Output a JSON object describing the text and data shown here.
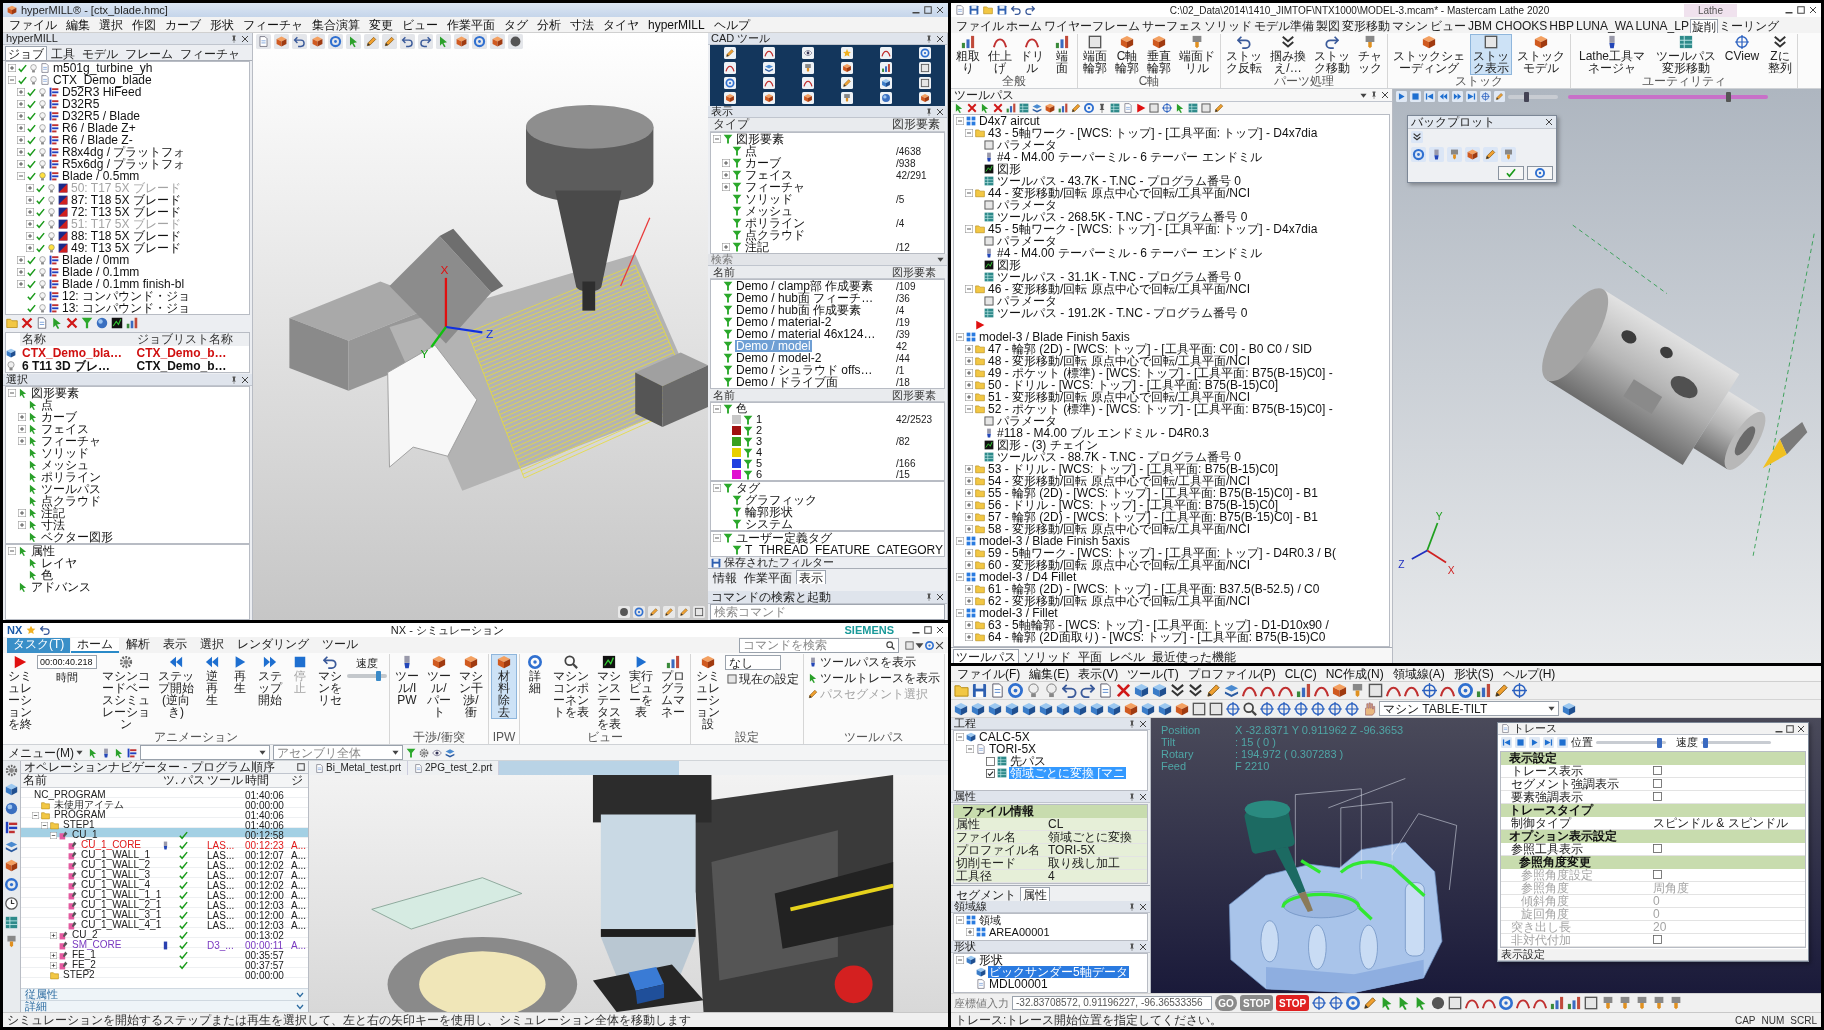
{
  "hypermill": {
    "title": "hyperMILL® - [ctx_blade.hmc]",
    "menu": [
      "ファイル",
      "編集",
      "選択",
      "作図",
      "カーブ",
      "形状",
      "フィーチャ",
      "集合演算",
      "変更",
      "ビュー",
      "作業平面",
      "タグ",
      "分析",
      "寸法",
      "タイヤ",
      "hyperMILL",
      "ヘルプ"
    ],
    "job_panel": {
      "title": "hyperMILL",
      "tabs": [
        {
          "label": "ジョブ",
          "selected": true
        },
        {
          "label": "工具",
          "selected": false
        },
        {
          "label": "モデル",
          "selected": false
        },
        {
          "label": "フレーム",
          "selected": false
        },
        {
          "label": "フィーチャ",
          "selected": false
        }
      ],
      "tree": [
        {
          "label": "m501g_turbine_yh",
          "kind": "project",
          "expanded": false,
          "checked": true,
          "lit": false
        },
        {
          "label": "CTX_Demo_blade",
          "kind": "project",
          "expanded": true,
          "checked": true,
          "lit": false,
          "children": [
            {
              "label": "D52R3 HiFeed",
              "kind": "job",
              "expanded": false,
              "checked": true,
              "lit": false
            },
            {
              "label": "D32R5",
              "kind": "job",
              "expanded": false,
              "checked": true,
              "lit": false
            },
            {
              "label": "D32R5 / Blade",
              "kind": "job",
              "expanded": false,
              "checked": true,
              "lit": false
            },
            {
              "label": "R6 / Blade Z+",
              "kind": "job",
              "expanded": false,
              "checked": true,
              "lit": false
            },
            {
              "label": "R6 / Blade Z-",
              "kind": "job",
              "expanded": false,
              "checked": true,
              "lit": false
            },
            {
              "label": "R8x4dg / プラットフォ",
              "kind": "job",
              "expanded": false,
              "checked": true,
              "lit": false
            },
            {
              "label": "R5x6dg / プラットフォ",
              "kind": "job",
              "expanded": false,
              "checked": true,
              "lit": false
            },
            {
              "label": "Blade / 0.5mm",
              "kind": "job",
              "expanded": true,
              "checked": true,
              "lit": true,
              "children": [
                {
                  "label": "50: T17 5X ブレード",
                  "kind": "operation",
                  "expanded": false,
                  "checked": true,
                  "lit": false,
                  "disabled": true
                },
                {
                  "label": "87: T18 5X ブレード",
                  "kind": "operation",
                  "expanded": false,
                  "checked": true,
                  "lit": false,
                  "disabled": false
                },
                {
                  "label": "72: T13 5X ブレード",
                  "kind": "operation",
                  "expanded": false,
                  "checked": true,
                  "lit": false,
                  "disabled": false
                },
                {
                  "label": "51: T17 5X ブレード",
                  "kind": "operation",
                  "expanded": false,
                  "checked": true,
                  "lit": false,
                  "disabled": true
                },
                {
                  "label": "88: T18 5X ブレード",
                  "kind": "operation",
                  "expanded": false,
                  "checked": true,
                  "lit": false,
                  "disabled": false
                },
                {
                  "label": "49: T13 5X ブレード",
                  "kind": "operation",
                  "expanded": false,
                  "checked": true,
                  "lit": true,
                  "disabled": false
                }
              ]
            },
            {
              "label": "Blade / 0mm",
              "kind": "job",
              "expanded": false,
              "checked": true,
              "lit": false
            },
            {
              "label": "Blade / 0.1mm",
              "kind": "job",
              "expanded": false,
              "checked": true,
              "lit": false
            },
            {
              "label": "Blade / 0.1mm finish-bl",
              "kind": "job",
              "expanded": false,
              "checked": true,
              "lit": false
            },
            {
              "label": "12: コンパウンド・ジョ",
              "kind": "job",
              "checked": true,
              "lit": false
            },
            {
              "label": "13: コンパウンド・ジョ",
              "kind": "job",
              "checked": true,
              "lit": false
            }
          ]
        }
      ],
      "list": {
        "columns": [
          "名称",
          "ジョブリスト名称"
        ],
        "rows": [
          {
            "cells": [
              "CTX_Demo_bla…",
              "CTX_Demo_b…"
            ],
            "active": true
          },
          {
            "cells": [
              "6 T11 3D ブレ…",
              "CTX_Demo_b…"
            ],
            "active": false
          }
        ]
      }
    },
    "selection_panel": {
      "title": "選択",
      "tree": [
        {
          "label": "図形要素",
          "expanded": true,
          "children": [
            {
              "label": "点"
            },
            {
              "label": "カーブ",
              "expanded": false
            },
            {
              "label": "フェイス",
              "expanded": false
            },
            {
              "label": "フィーチャ",
              "expanded": false
            },
            {
              "label": "ソリッド"
            },
            {
              "label": "メッシュ"
            },
            {
              "label": "ポリライン"
            },
            {
              "label": "ツールパス"
            },
            {
              "label": "点クラウド"
            },
            {
              "label": "注記",
              "expanded": false
            },
            {
              "label": "寸法",
              "expanded": false
            },
            {
              "label": "ベクター図形"
            }
          ]
        }
      ],
      "attributes": [
        {
          "label": "属性",
          "expanded": true,
          "children": [
            {
              "label": "レイヤ"
            },
            {
              "label": "色"
            }
          ]
        },
        {
          "label": "アドバンス"
        }
      ]
    },
    "axes": [
      "X",
      "Y",
      "Z"
    ],
    "cad_tools": {
      "title": "CAD ツール"
    },
    "display_panel": {
      "title": "表示",
      "columns": [
        "タイプ",
        "図形要素"
      ],
      "tree": [
        {
          "label": "図形要素",
          "expanded": true,
          "children": [
            {
              "label": "点",
              "count": "/4638"
            },
            {
              "label": "カーブ",
              "count": "/938",
              "expanded": false
            },
            {
              "label": "フェイス",
              "count": "42/291",
              "expanded": false
            },
            {
              "label": "フィーチャ",
              "expanded": false
            },
            {
              "label": "ソリッド",
              "count": "/5"
            },
            {
              "label": "メッシュ"
            },
            {
              "label": "ポリライン",
              "count": "/4"
            },
            {
              "label": "点クラウド"
            },
            {
              "label": "注記",
              "count": "/12",
              "expanded": false
            }
          ]
        }
      ]
    },
    "search_label": "検索",
    "model_list": {
      "columns": [
        "名前",
        "図形要素"
      ],
      "rows": [
        {
          "label": "Demo / clamp部 作成要素",
          "count": "/109",
          "selected": false
        },
        {
          "label": "Demo / hub面 フィーチ…",
          "count": "/36",
          "selected": false
        },
        {
          "label": "Demo / hub面 作成要素",
          "count": "/4",
          "selected": false
        },
        {
          "label": "Demo / material-2",
          "count": "/19",
          "selected": false
        },
        {
          "label": "Demo / material 46x124…",
          "count": "/39",
          "selected": false
        },
        {
          "label": "Demo / model",
          "count": "42",
          "selected": true
        },
        {
          "label": "Demo / model-2",
          "count": "/44",
          "selected": false
        },
        {
          "label": "Demo / シュラウド offs…",
          "count": "/1",
          "selected": false
        },
        {
          "label": "Demo / ドライブ面",
          "count": "/18",
          "selected": false
        }
      ]
    },
    "color_list": {
      "columns": [
        "名前",
        "図形要素"
      ],
      "tree": [
        {
          "label": "色",
          "expanded": true,
          "children": [
            {
              "label": "1",
              "count": "42/2523",
              "color": "#c8c8c8"
            },
            {
              "label": "2",
              "color": "#a01010"
            },
            {
              "label": "3",
              "count": "/82",
              "color": "#3aa020"
            },
            {
              "label": "4",
              "color": "#e8d000"
            },
            {
              "label": "5",
              "count": "/166",
              "color": "#2040e0"
            },
            {
              "label": "6",
              "count": "/15",
              "color": "#e010d0"
            }
          ]
        }
      ]
    },
    "tag_tree": [
      {
        "label": "タグ",
        "expanded": true,
        "children": [
          {
            "label": "グラフィック"
          },
          {
            "label": "輪郭形状"
          },
          {
            "label": "システム"
          }
        ]
      }
    ],
    "user_tag_tree": [
      {
        "label": "ユーザー定義タグ",
        "expanded": true,
        "children": [
          {
            "label": "T_THREAD_FEATURE_CATEGORY"
          }
        ]
      }
    ],
    "saved_filters": "保存されたフィルター",
    "bottom_tabs": [
      {
        "label": "情報",
        "selected": false
      },
      {
        "label": "作業平面",
        "selected": false
      },
      {
        "label": "表示",
        "selected": true
      }
    ],
    "command_panel": {
      "title": "コマンドの検索と起動",
      "placeholder": "検索コマンド"
    }
  },
  "mastercam": {
    "title": "C:\\02_Data\\2014\\1410_JIMTOF\\NTX1000\\MODEL-3.mcam* - Mastercam Lathe 2020",
    "context": "Lathe",
    "tabs": [
      {
        "label": "ファイル",
        "selected": false
      },
      {
        "label": "ホーム",
        "selected": false
      },
      {
        "label": "ワイヤーフレーム",
        "selected": false
      },
      {
        "label": "サーフェス",
        "selected": false
      },
      {
        "label": "ソリッド",
        "selected": false
      },
      {
        "label": "モデル準備",
        "selected": false
      },
      {
        "label": "製図",
        "selected": false
      },
      {
        "label": "変形移動",
        "selected": false
      },
      {
        "label": "マシン",
        "selected": false
      },
      {
        "label": "ビュー",
        "selected": false
      },
      {
        "label": "JBM CHOOKS",
        "selected": false
      },
      {
        "label": "HBP",
        "selected": false
      },
      {
        "label": "LUNA_WA",
        "selected": false
      },
      {
        "label": "LUNA_LP",
        "selected": false
      },
      {
        "label": "旋削",
        "selected": true
      },
      {
        "label": "ミーリング",
        "selected": false
      }
    ],
    "ribbon": [
      {
        "label": "全般",
        "buttons": [
          {
            "label": "粗取り",
            "selected": false
          },
          {
            "label": "仕上げ",
            "selected": false
          },
          {
            "label": "ドリル",
            "selected": false
          },
          {
            "label": "端面",
            "selected": false
          }
        ]
      },
      {
        "label": "C軸",
        "buttons": [
          {
            "label": "端面輪郭",
            "selected": false
          },
          {
            "label": "C軸輪郭",
            "selected": false
          },
          {
            "label": "垂直輪郭",
            "selected": false
          },
          {
            "label": "端面ドリル",
            "selected": false
          }
        ]
      },
      {
        "label": "パーツ処理",
        "buttons": [
          {
            "label": "ストック反転",
            "selected": false
          },
          {
            "label": "掴み換え/…",
            "selected": false
          },
          {
            "label": "ストック移動",
            "selected": false
          },
          {
            "label": "チャック",
            "selected": false
          }
        ]
      },
      {
        "label": "ストック",
        "buttons": [
          {
            "label": "ストックシェーディング",
            "selected": false
          },
          {
            "label": "ストック表示",
            "selected": true
          },
          {
            "label": "ストックモデル",
            "selected": false
          }
        ]
      },
      {
        "label": "ユーティリティ",
        "buttons": [
          {
            "label": "Lathe工具マネージャ",
            "selected": false
          },
          {
            "label": "ツールパス変形移動",
            "selected": false
          },
          {
            "label": "CView",
            "selected": false
          },
          {
            "label": "Zに整列",
            "selected": false
          }
        ]
      }
    ],
    "toolpath_panel": {
      "title": "ツールパス",
      "tree": [
        {
          "label": "D4x7 aircut",
          "kind": "group",
          "expanded": true,
          "children": [
            {
              "label": "43 - 5軸ワーク - [WCS: トップ] - [工具平面: トップ] - D4x7dia",
              "kind": "op",
              "expanded": true,
              "children": [
                {
                  "label": "パラメータ",
                  "kind": "param"
                },
                {
                  "label": "#4 - M4.00 テーパーミル - 6 テーパー エンドミル",
                  "kind": "tool"
                },
                {
                  "label": "図形",
                  "kind": "geom"
                },
                {
                  "label": "ツールパス - 43.7K - T.NC - プログラム番号 0",
                  "kind": "path"
                }
              ]
            },
            {
              "label": "44 - 変形移動/回転 原点中心で回転/工具平面/NCI",
              "kind": "op",
              "expanded": true,
              "children": [
                {
                  "label": "パラメータ",
                  "kind": "param"
                },
                {
                  "label": "ツールパス - 268.5K - T.NC - プログラム番号 0",
                  "kind": "path"
                }
              ]
            },
            {
              "label": "45 - 5軸ワーク - [WCS: トップ] - [工具平面: トップ] - D4x7dia",
              "kind": "op",
              "expanded": true,
              "children": [
                {
                  "label": "パラメータ",
                  "kind": "param"
                },
                {
                  "label": "#4 - M4.00 テーパーミル - 6 テーパー エンドミル",
                  "kind": "tool"
                },
                {
                  "label": "図形",
                  "kind": "geom"
                },
                {
                  "label": "ツールパス - 31.1K - T.NC - プログラム番号 0",
                  "kind": "path"
                }
              ]
            },
            {
              "label": "46 - 変形移動/回転 原点中心で回転/工具平面/NCI",
              "kind": "op",
              "expanded": true,
              "children": [
                {
                  "label": "パラメータ",
                  "kind": "param"
                },
                {
                  "label": "ツールパス - 191.2K - T.NC - プログラム番号 0",
                  "kind": "path"
                }
              ]
            },
            {
              "kind": "marker"
            }
          ]
        },
        {
          "label": "model-3 / Blade Finish 5axis",
          "kind": "group",
          "expanded": true,
          "children": [
            {
              "label": "47 - 輪郭 (2D) - [WCS: トップ] - [工具平面: C0] - B0 C0 / SID",
              "kind": "op",
              "expanded": false
            },
            {
              "label": "48 - 変形移動/回転 原点中心で回転/工具平面/NCI",
              "kind": "op",
              "expanded": false
            },
            {
              "label": "49 - ポケット (標準) - [WCS: トップ] - [工具平面: B75(B-15)C0] -",
              "kind": "op",
              "expanded": false
            },
            {
              "label": "50 - ドリル - [WCS: トップ] - [工具平面: B75(B-15)C0]",
              "kind": "op",
              "expanded": false
            },
            {
              "label": "51 - 変形移動/回転 原点中心で回転/工具平面/NCI",
              "kind": "op",
              "expanded": false
            },
            {
              "label": "52 - ポケット (標準) - [WCS: トップ] - [工具平面: B75(B-15)C0] -",
              "kind": "op",
              "expanded": true,
              "children": [
                {
                  "label": "パラメータ",
                  "kind": "param"
                },
                {
                  "label": "#118 - M4.00 ブル エンドミル - D4R0.3",
                  "kind": "tool"
                },
                {
                  "label": "図形 - (3) チェイン",
                  "kind": "geom"
                },
                {
                  "label": "ツールパス - 88.7K - T.NC - プログラム番号 0",
                  "kind": "path"
                }
              ]
            },
            {
              "label": "53 - ドリル - [WCS: トップ] - [工具平面: B75(B-15)C0]",
              "kind": "op",
              "expanded": false
            },
            {
              "label": "54 - 変形移動/回転 原点中心で回転/工具平面/NCI",
              "kind": "op",
              "expanded": false
            },
            {
              "label": "55 - 輪郭 (2D) - [WCS: トップ] - [工具平面: B75(B-15)C0] - B1",
              "kind": "op",
              "expanded": false
            },
            {
              "label": "56 - ドリル - [WCS: トップ] - [工具平面: B75(B-15)C0]",
              "kind": "op",
              "expanded": false
            },
            {
              "label": "57 - 輪郭 (2D) - [WCS: トップ] - [工具平面: B75(B-15)C0] - B1",
              "kind": "op",
              "expanded": false
            },
            {
              "label": "58 - 変形移動/回転 原点中心で回転/工具平面/NCI",
              "kind": "op",
              "expanded": false
            }
          ]
        },
        {
          "label": "model-3 / Blade Finish 5axis",
          "kind": "group",
          "expanded": true,
          "children": [
            {
              "label": "59 - 5軸ワーク - [WCS: トップ] - [工具平面: トップ] - D4R0.3 / B(",
              "kind": "op",
              "expanded": false
            },
            {
              "label": "60 - 変形移動/回転 原点中心で回転/工具平面/NCI",
              "kind": "op",
              "expanded": false
            }
          ]
        },
        {
          "label": "model-3 / D4 Fillet",
          "kind": "group",
          "expanded": true,
          "children": [
            {
              "label": "61 - 輪郭 (2D) - [WCS: トップ] - [工具平面: B37.5(B-52.5) / C0",
              "kind": "op",
              "expanded": false
            },
            {
              "label": "62 - 変形移動/回転 原点中心で回転/工具平面/NCI",
              "kind": "op",
              "expanded": false
            }
          ]
        },
        {
          "label": "model-3 / Fillet",
          "kind": "group",
          "expanded": true,
          "children": [
            {
              "label": "63 - 5軸輪郭 - [WCS: トップ] - [工具平面: トップ] - D1-D10x90 /",
              "kind": "op",
              "expanded": false
            },
            {
              "label": "64 - 輪郭 (2D面取り) - [WCS: トップ] - [工具平面: B75(B-15)C0",
              "kind": "op",
              "expanded": false
            }
          ]
        }
      ]
    },
    "bottom_tabs": [
      {
        "label": "ツールパス",
        "selected": true
      },
      {
        "label": "ソリッド",
        "selected": false
      },
      {
        "label": "平面",
        "selected": false
      },
      {
        "label": "レベル",
        "selected": false
      },
      {
        "label": "最近使った機能",
        "selected": false
      }
    ],
    "playback": {
      "speed": {
        "level": 0.35
      },
      "timeline": {
        "level": 0.8
      }
    },
    "backplot": {
      "title": "バックプロット"
    },
    "axes": [
      "Y",
      "Z",
      "X"
    ]
  },
  "nx_simulation": {
    "logo": "NX",
    "title": "NX - シミュレーション",
    "brand": "SIEMENS",
    "tabs": [
      {
        "label": "タスク(T)",
        "kind": "menu",
        "selected": false
      },
      {
        "label": "ホーム",
        "kind": "tab",
        "selected": true
      },
      {
        "label": "解析",
        "kind": "tab",
        "selected": false
      },
      {
        "label": "表示",
        "kind": "tab",
        "selected": false
      },
      {
        "label": "選択",
        "kind": "tab",
        "selected": false
      },
      {
        "label": "レンダリング",
        "kind": "tab",
        "selected": false
      },
      {
        "label": "ツール",
        "kind": "tab",
        "selected": false
      }
    ],
    "search_placeholder": "コマンドを検索",
    "ribbon": [
      {
        "label": "アニメーション",
        "items": [
          {
            "kind": "button",
            "label": "シミュレーションを終",
            "selected": false,
            "disabled": false
          },
          {
            "kind": "time",
            "value": "00:00:40.218",
            "label": "時間"
          },
          {
            "kind": "button",
            "label": "マシンコードベースシミュレーション",
            "selected": false,
            "disabled": false
          },
          {
            "kind": "button",
            "label": "ステップ開始(逆向き)",
            "selected": false,
            "disabled": false
          },
          {
            "kind": "button",
            "label": "逆再生",
            "selected": false,
            "disabled": false
          },
          {
            "kind": "button",
            "label": "再生",
            "selected": false,
            "disabled": false
          },
          {
            "kind": "button",
            "label": "ステップ開始",
            "selected": false,
            "disabled": false
          },
          {
            "kind": "button",
            "label": "停止",
            "selected": false,
            "disabled": true
          },
          {
            "kind": "button",
            "label": "マシンをリセ",
            "selected": false,
            "disabled": false
          },
          {
            "kind": "slider",
            "label": "速度",
            "level": 0.78
          }
        ]
      },
      {
        "label": "干渉/衝突",
        "items": [
          {
            "kind": "button",
            "label": "ツール/IPW",
            "selected": false,
            "disabled": false
          },
          {
            "kind": "button",
            "label": "ツール/パート",
            "selected": false,
            "disabled": false
          },
          {
            "kind": "button",
            "label": "マシン干渉/衝",
            "selected": false,
            "disabled": false
          }
        ]
      },
      {
        "label": "IPW",
        "items": [
          {
            "kind": "button",
            "label": "材料除去",
            "selected": true,
            "disabled": false
          }
        ]
      },
      {
        "label": "ビュー",
        "items": [
          {
            "kind": "button",
            "label": "詳細",
            "selected": false,
            "disabled": false
          },
          {
            "kind": "button",
            "label": "マシンコンポーネントを表",
            "selected": false,
            "disabled": false
          },
          {
            "kind": "button",
            "label": "マシンステータスを表",
            "selected": false,
            "disabled": false
          },
          {
            "kind": "button",
            "label": "実行ビューを表",
            "selected": false,
            "disabled": false
          },
          {
            "kind": "button",
            "label": "プログラムマネー",
            "selected": false,
            "disabled": false
          }
        ]
      },
      {
        "label": "設定",
        "items": [
          {
            "kind": "button",
            "label": "シミュレーション設",
            "selected": false,
            "disabled": false
          },
          {
            "kind": "field",
            "value": "なし"
          },
          {
            "kind": "small",
            "label": "現在の設定",
            "disabled": false
          }
        ]
      },
      {
        "label": "ツールパス",
        "items": [
          {
            "kind": "small",
            "label": "ツールパスを表示",
            "disabled": false
          },
          {
            "kind": "small",
            "label": "ツールトレースを表示",
            "disabled": false
          },
          {
            "kind": "small",
            "label": "パスセグメント選択",
            "disabled": true
          }
        ]
      }
    ],
    "menu_button": "メニュー(M)",
    "assembly_filter": "アセンブリ全体",
    "navigator": {
      "title": "オペレーションナビゲーター - プログラム順序",
      "columns": [
        "名前",
        "ツ.",
        "パス",
        "ツール",
        "時間",
        "ジ"
      ],
      "tree": [
        {
          "name": "NC_PROGRAM",
          "time": "01:40:06",
          "path_ok": false,
          "children": [
            {
              "name": "未使用アイテム",
              "kind": "folder",
              "time": "00:00:00",
              "path_ok": false
            },
            {
              "name": "PROGRAM",
              "kind": "folder",
              "expanded": true,
              "time": "01:40:06",
              "path_ok": false,
              "children": [
                {
                  "name": "STEP1",
                  "kind": "folder",
                  "expanded": true,
                  "time": "01:40:06",
                  "path_ok": false,
                  "children": [
                    {
                      "name": "CU_1",
                      "kind": "group",
                      "expanded": true,
                      "selected": true,
                      "path_ok": true,
                      "time": "00:12:58",
                      "children": [
                        {
                          "name": "CU_1_CORE",
                          "kind": "operation",
                          "tool_marker": true,
                          "path_ok": true,
                          "tool": "LAS...",
                          "time": "00:12:23",
                          "column_6": "A...",
                          "color": "#e01818"
                        },
                        {
                          "name": "CU_1_WALL_1",
                          "kind": "operation",
                          "path_ok": true,
                          "tool": "LAS...",
                          "time": "00:12:07",
                          "column_6": "A..."
                        },
                        {
                          "name": "CU_1_WALL_2",
                          "kind": "operation",
                          "path_ok": true,
                          "tool": "LAS...",
                          "time": "00:12:02",
                          "column_6": "A..."
                        },
                        {
                          "name": "CU_1_WALL_3",
                          "kind": "operation",
                          "path_ok": true,
                          "tool": "LAS...",
                          "time": "00:12:07",
                          "column_6": "A..."
                        },
                        {
                          "name": "CU_1_WALL_4",
                          "kind": "operation",
                          "path_ok": true,
                          "tool": "LAS...",
                          "time": "00:12:02",
                          "column_6": "A..."
                        },
                        {
                          "name": "CU_1_WALL_1_1",
                          "kind": "operation",
                          "path_ok": true,
                          "tool": "LAS...",
                          "time": "00:12:00",
                          "column_6": "A..."
                        },
                        {
                          "name": "CU_1_WALL_2_1",
                          "kind": "operation",
                          "path_ok": true,
                          "tool": "LAS...",
                          "time": "00:12:03",
                          "column_6": "A..."
                        },
                        {
                          "name": "CU_1_WALL_3_1",
                          "kind": "operation",
                          "path_ok": true,
                          "tool": "LAS...",
                          "time": "00:12:00",
                          "column_6": "A..."
                        },
                        {
                          "name": "CU_1_WALL_4_1",
                          "kind": "operation",
                          "path_ok": true,
                          "tool": "LAS...",
                          "time": "00:12:03",
                          "column_6": "A..."
                        }
                      ]
                    },
                    {
                      "name": "CU_2",
                      "kind": "group",
                      "expanded": false,
                      "selected": false,
                      "path_ok": true,
                      "time": "00:13:02"
                    },
                    {
                      "name": "SM_CORE",
                      "kind": "group",
                      "bar_marker": true,
                      "path_ok": true,
                      "tool": "D3_...",
                      "time": "00:00:11",
                      "column_6": "A...",
                      "color": "#7a3ac0"
                    },
                    {
                      "name": "FE_1",
                      "kind": "group",
                      "expanded": false,
                      "path_ok": true,
                      "time": "00:35:57"
                    },
                    {
                      "name": "FE_2",
                      "kind": "group",
                      "expanded": false,
                      "path_ok": true,
                      "time": "00:37:57"
                    }
                  ]
                },
                {
                  "name": "STEP2",
                  "kind": "folder",
                  "time": "00:00:00",
                  "path_ok": false
                }
              ]
            }
          ]
        }
      ]
    },
    "doc_tabs": [
      {
        "label": "Bi_Metal_test.prt",
        "selected": false
      },
      {
        "label": "2PG_test_2.prt",
        "selected": false
      }
    ],
    "footer": [
      {
        "label": "従属性",
        "expanded": false
      },
      {
        "label": "詳細",
        "expanded": false
      }
    ],
    "status": "シミュレーションを開始するステップまたは再生を選択して、左と右の矢印キーを使用し、シミュレーション全体を移動します"
  },
  "trace_window": {
    "menu": [
      "ファイル(F)",
      "編集(E)",
      "表示(V)",
      "ツール(T)",
      "プロファイル(P)",
      "CL(C)",
      "NC作成(N)",
      "領域線(A)",
      "形状(S)",
      "ヘルプ(H)"
    ],
    "machine": "マシン TABLE-TILT",
    "process_panel": {
      "title": "工程",
      "tree": [
        {
          "label": "CALC-5X",
          "kind": "project",
          "expanded": true,
          "children": [
            {
              "label": "TORI-5X",
              "kind": "setup",
              "expanded": true,
              "children": [
                {
                  "label": "先パス",
                  "kind": "path",
                  "checked": false,
                  "selected": false
                },
                {
                  "label": "領域ごとに変換 [マニ",
                  "kind": "path",
                  "checked": true,
                  "selected": true
                }
              ]
            }
          ]
        }
      ]
    },
    "readout": [
      {
        "label": "Position",
        "value": "X -32.8371  Y 0.911962  Z -96.3653"
      },
      {
        "label": "Tilt",
        "value": ": 15  ( 0 )"
      },
      {
        "label": "Rotary",
        "value": ": 194.972  ( 0.307283 )"
      },
      {
        "label": "Feed",
        "value": "F 2210"
      }
    ],
    "attr_panel": {
      "title": "属性",
      "section": "ファイル情報",
      "rows": [
        {
          "label": "属性",
          "value": "CL"
        },
        {
          "label": "ファイル名",
          "value": "領域ごとに変換"
        },
        {
          "label": "プロファイル名",
          "value": "TORI-5X"
        },
        {
          "label": "切削モード",
          "value": "取り残し加工"
        },
        {
          "label": "工具径",
          "value": "4"
        }
      ],
      "tabs": [
        {
          "label": "セグメント",
          "selected": false
        },
        {
          "label": "属性",
          "selected": true
        }
      ]
    },
    "area_panel": {
      "title": "領域線",
      "tree": [
        {
          "label": "領域",
          "kind": "area",
          "expanded": true,
          "children": [
            {
              "label": "AREA00001",
              "kind": "area",
              "expanded": false
            }
          ]
        }
      ]
    },
    "shape_panel": {
      "title": "形状",
      "tree": [
        {
          "label": "形状",
          "kind": "shape",
          "expanded": true,
          "children": [
            {
              "label": "ビックサンダー5軸データ",
              "kind": "shape",
              "selected": true
            },
            {
              "label": "MDL00001",
              "kind": "model",
              "selected": false
            }
          ]
        }
      ]
    },
    "trace_dialog": {
      "title": "トレース",
      "position": {
        "label": "位置",
        "level": 0.9
      },
      "speed": {
        "label": "速度",
        "level": 0.05
      },
      "groups": [
        {
          "label": "表示設定",
          "rows": [
            {
              "label": "トレース表示",
              "kind": "check",
              "checked": false,
              "disabled": false
            },
            {
              "label": "セグメント強調表示",
              "kind": "check",
              "checked": false,
              "disabled": false
            },
            {
              "label": "要素強調表示",
              "kind": "check",
              "checked": false,
              "disabled": false
            }
          ]
        },
        {
          "label": "トレースタイプ",
          "rows": [
            {
              "label": "制御タイプ",
              "kind": "text",
              "value": "スピンドル & スピンドル",
              "disabled": false
            }
          ]
        },
        {
          "label": "オプション表示設定",
          "rows": [
            {
              "label": "参照工具表示",
              "kind": "check",
              "checked": false,
              "disabled": false
            },
            {
              "label": "参照角度変更",
              "kind": "subgroup",
              "rows": [
                {
                  "label": "参照角度設定",
                  "kind": "check",
                  "checked": false,
                  "disabled": true
                },
                {
                  "label": "参照角度",
                  "kind": "text",
                  "value": "周角度",
                  "disabled": true
                },
                {
                  "label": "傾斜角度",
                  "kind": "text",
                  "value": "0",
                  "disabled": true
                },
                {
                  "label": "旋回角度",
                  "kind": "text",
                  "value": "0",
                  "disabled": true
                }
              ]
            },
            {
              "label": "突き出し長",
              "kind": "text",
              "value": "20",
              "disabled": true
            },
            {
              "label": "非対代付加",
              "kind": "check",
              "checked": false,
              "disabled": true
            }
          ]
        }
      ],
      "footer": "表示設定"
    },
    "coord_input": {
      "label": "座標値入力",
      "value": "-32.83708572, 0.91196227, -96.36533356"
    },
    "run_buttons": [
      {
        "label": "GO",
        "kind": "go"
      },
      {
        "label": "STOP",
        "kind": "stop"
      },
      {
        "label": "STOP",
        "kind": "halt"
      }
    ],
    "status": "トレース:トレース開始位置を指定してください。",
    "indicators": [
      "CAP",
      "NUM",
      "SCRL"
    ]
  }
}
